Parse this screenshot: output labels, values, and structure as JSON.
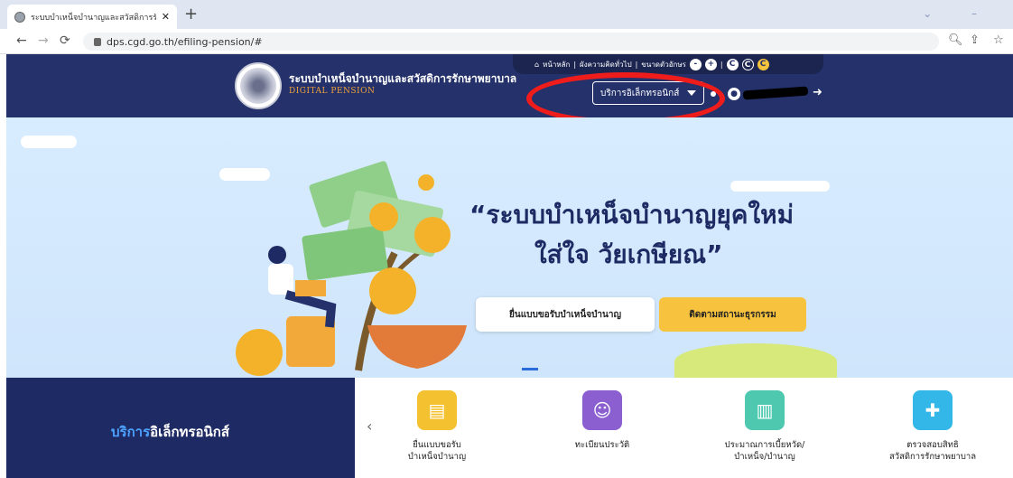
{
  "browser": {
    "tab_title": "ระบบบำเหน็จบำนาญและสวัสดิการรักษ",
    "tab_close": "✕",
    "new_tab": "+",
    "url": "dps.cgd.go.th/efiling-pension/#",
    "window_controls": "⌄ –"
  },
  "header": {
    "top_links": [
      "หน้าหลัก",
      "ผังความคิดทั่วไป",
      "ขนาดตัวอักษร"
    ],
    "font_buttons": [
      "-",
      "+"
    ],
    "contrast_buttons": [
      "C",
      "C",
      "C"
    ],
    "site_name": "ระบบบำเหน็จบำนาญและสวัสดิการรักษาพยาบาล",
    "site_sub": "DIGITAL PENSION",
    "service_dropdown": "บริการอิเล็กทรอนิกส์"
  },
  "hero": {
    "headline_1": "“ระบบบำเหน็จบำนาญยุคใหม่",
    "headline_2": "ใส่ใจ วัยเกษียณ”",
    "button_submit": "ยื่นแบบขอรับบำเหน็จบำนาญ",
    "button_track": "ติดตามสถานะธุรกรรม"
  },
  "services": {
    "panel_title_part1": "บริการ",
    "panel_title_part2": "อิเล็กทรอนิกส์",
    "items": [
      {
        "label_1": "ยื่นแบบขอรับ",
        "label_2": "บำเหน็จบำนาญ",
        "color": "#f4c230",
        "icon": "form-icon"
      },
      {
        "label_1": "ทะเบียนประวัติ",
        "label_2": "",
        "color": "#8b5fd0",
        "icon": "profile-icon"
      },
      {
        "label_1": "ประมาณการเบี้ยหวัด/",
        "label_2": "บำเหน็จ/บำนาญ",
        "color": "#4ec9b0",
        "icon": "chart-icon"
      },
      {
        "label_1": "ตรวจสอบสิทธิ",
        "label_2": "สวัสดิการรักษาพยาบาล",
        "color": "#33b6e8",
        "icon": "medical-icon"
      }
    ]
  }
}
